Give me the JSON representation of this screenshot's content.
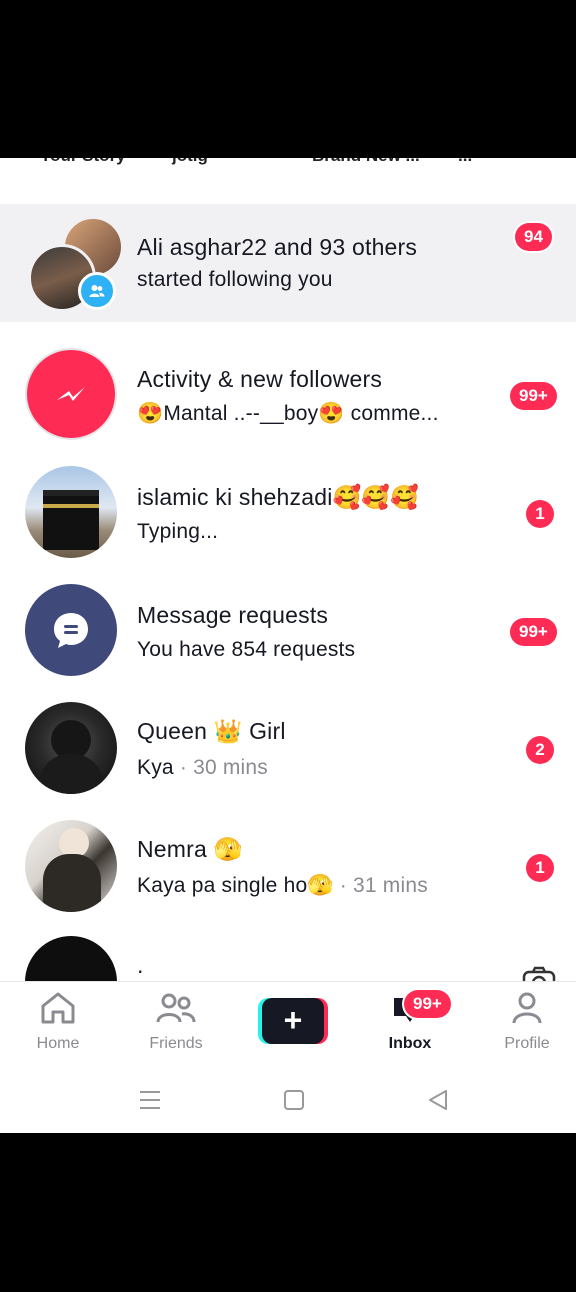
{
  "stories": [
    "Your Story",
    "jotig",
    "Brand New ...",
    "..."
  ],
  "notifications": {
    "followers": {
      "title": "Ali asghar22 and 93 others",
      "subtitle": "started following you",
      "badge": "94"
    },
    "activity": {
      "title": "Activity & new followers",
      "subtitle": "😍Mantal ..--__boy😍 comme...",
      "badge": "99+"
    }
  },
  "conversations": [
    {
      "name": "islamic ki shehzadi🥰🥰🥰",
      "preview": "Typing...",
      "time": "",
      "badge": "1"
    },
    {
      "name": "Message requests",
      "preview": "You have 854 requests",
      "time": "",
      "badge": "99+"
    },
    {
      "name": "Queen 👑 Girl",
      "preview": "Kya",
      "time": "· 30 mins",
      "badge": "2"
    },
    {
      "name": "Nemra 🫣",
      "preview": "Kaya pa single ho🫣",
      "time": "· 31 mins",
      "badge": "1"
    },
    {
      "name": ".",
      "preview": "",
      "time": "",
      "badge": ""
    }
  ],
  "tabbar": {
    "home": "Home",
    "friends": "Friends",
    "create": "+",
    "inbox": "Inbox",
    "inbox_badge": "99+",
    "profile": "Profile"
  },
  "colors": {
    "accent": "#fe2c55",
    "activity_icon_bg": "#fe2c55",
    "requests_icon_bg": "#3f4a7a",
    "text": "#161823",
    "muted": "#8a8b91"
  }
}
